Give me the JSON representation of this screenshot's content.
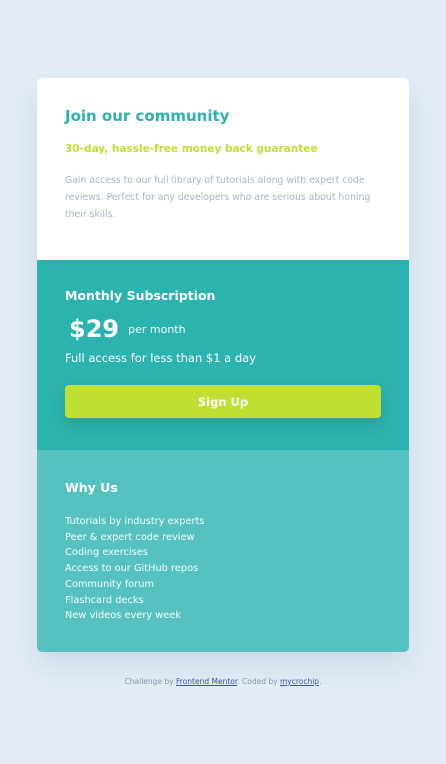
{
  "community": {
    "title": "Join our community",
    "tagline": "30-day, hassle-free money back guarantee",
    "description": "Gain access to our full library of tutorials along with expert code reviews. Perfect for any developers who are serious about honing their skills."
  },
  "subscription": {
    "title": "Monthly Subscription",
    "price": "$29",
    "period": "per month",
    "access_text": "Full access for less than $1 a day",
    "button_label": "Sign Up"
  },
  "why": {
    "title": "Why Us",
    "items": [
      "Tutorials by industry experts",
      "Peer & expert code review",
      "Coding exercises",
      "Access to our GitHub repos",
      "Community forum",
      "Flashcard decks",
      "New videos every week"
    ]
  },
  "footer": {
    "prefix": "Challenge by ",
    "link1": "Frontend Mentor",
    "middle": ". Coded by ",
    "link2": "mycrochip",
    "suffix": "."
  },
  "colors": {
    "background": "#e4edf6",
    "teal": "#2bb3b0",
    "light_teal": "#55c2c0",
    "lime": "#bfdf32",
    "gray_text": "#a9b3c8"
  }
}
